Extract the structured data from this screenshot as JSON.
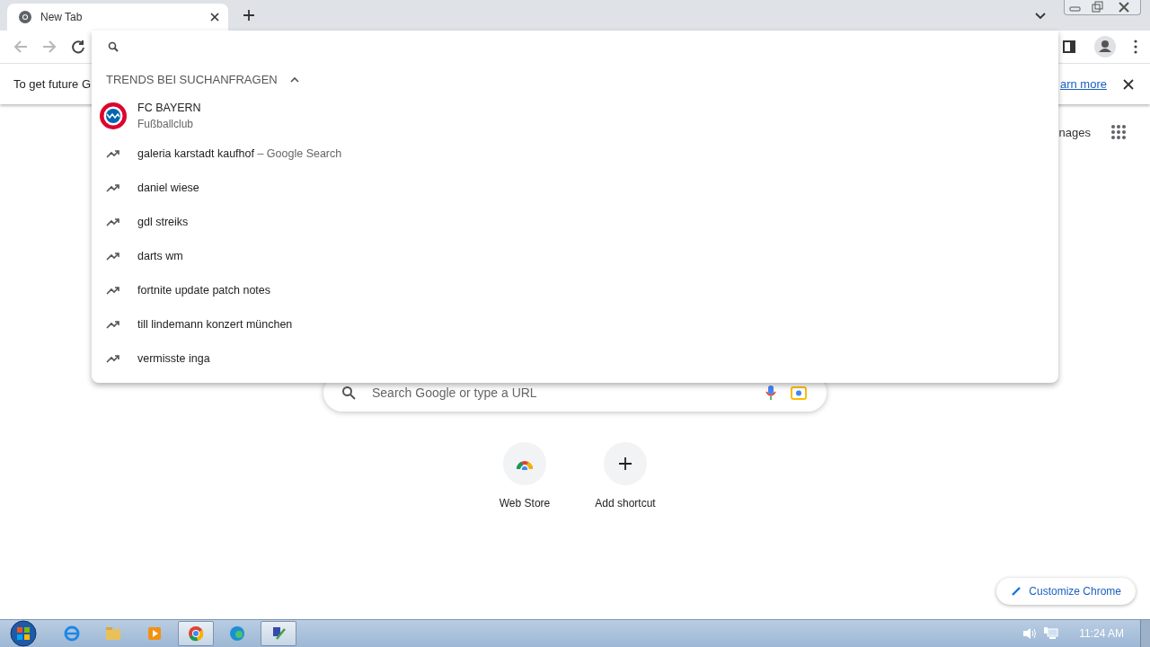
{
  "tab": {
    "title": "New Tab"
  },
  "toolbar": {
    "nav_buttons": [
      {
        "kind": "back",
        "disabled": true
      },
      {
        "kind": "forward",
        "disabled": true
      },
      {
        "kind": "reload",
        "disabled": false
      }
    ]
  },
  "infobar": {
    "text": "To get future G",
    "link": "arn more"
  },
  "omnibox_dropdown": {
    "header": "TRENDS BEI SUCHANFRAGEN",
    "expanded": true,
    "suggestions": [
      {
        "kind": "entity",
        "title": "FC BAYERN",
        "subtitle": "Fußballclub"
      },
      {
        "kind": "trend",
        "title": "galeria karstadt kaufhof",
        "suffix": "– Google Search"
      },
      {
        "kind": "trend",
        "title": "daniel wiese"
      },
      {
        "kind": "trend",
        "title": "gdl streiks"
      },
      {
        "kind": "trend",
        "title": "darts wm"
      },
      {
        "kind": "trend",
        "title": "fortnite update patch notes"
      },
      {
        "kind": "trend",
        "title": "till lindemann konzert münchen"
      },
      {
        "kind": "trend",
        "title": "vermisste inga"
      }
    ]
  },
  "new_tab_page": {
    "images_link": "nages",
    "search_placeholder": "Search Google or type a URL",
    "shortcuts": [
      {
        "kind": "webstore",
        "label": "Web Store"
      },
      {
        "kind": "add",
        "label": "Add shortcut"
      }
    ],
    "customize_button": "Customize Chrome"
  },
  "taskbar": {
    "apps": [
      {
        "kind": "ie",
        "active": false
      },
      {
        "kind": "folder",
        "active": false
      },
      {
        "kind": "media",
        "active": false
      },
      {
        "kind": "chrome",
        "active": true
      },
      {
        "kind": "edge",
        "active": false
      },
      {
        "kind": "tool",
        "active": true
      }
    ],
    "clock": "11:24 AM"
  }
}
